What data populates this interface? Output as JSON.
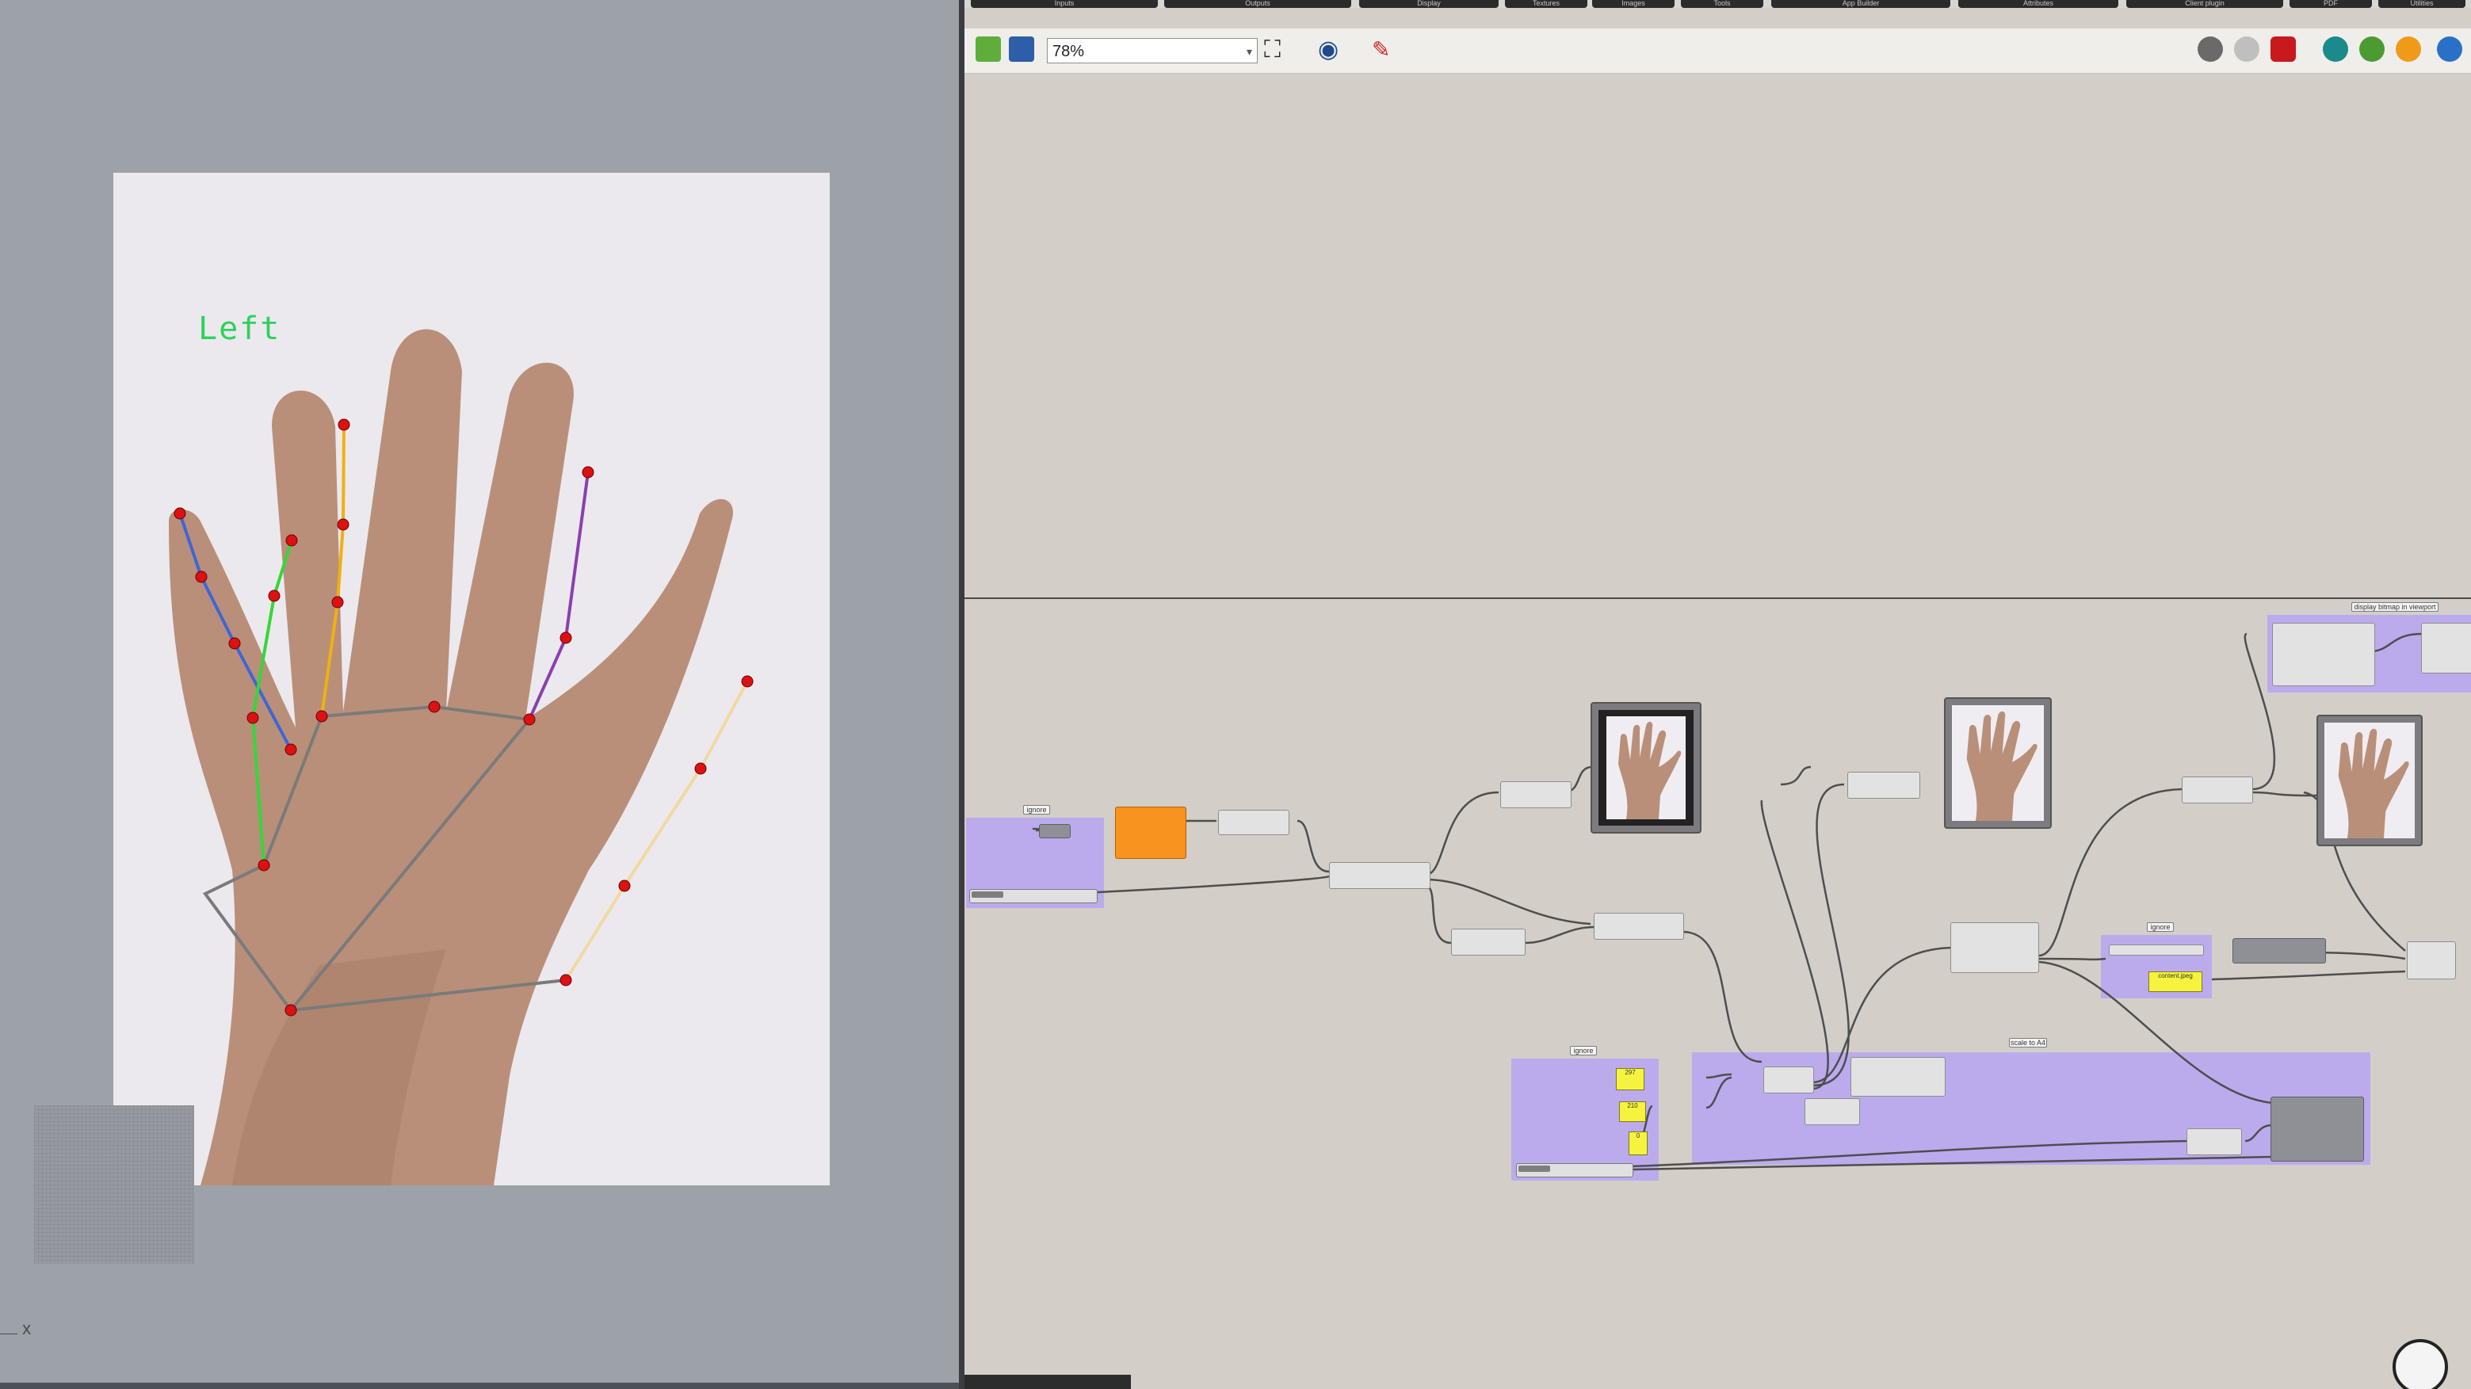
{
  "viewport": {
    "hand_label": "Left",
    "axis_label": "x"
  },
  "grasshopper": {
    "menu_tabs": [
      "Inputs",
      "Outputs",
      "Display",
      "Textures",
      "Images",
      "Tools",
      "App Builder",
      "Attributes",
      "Client plugin",
      "PDF",
      "Utilities"
    ],
    "zoom_value": "78%",
    "toolbar_icons": [
      "open-file-icon",
      "save-icon",
      "zoom-extents-icon",
      "preview-eye-icon",
      "sketch-brush-icon",
      "preview-off-icon",
      "wireframe-preview-icon",
      "shaded-preview-icon",
      "selected-only-icon",
      "mesh-preview-icon",
      "material-preview-icon",
      "globe-icon"
    ],
    "group_tags": {
      "left_group": "ignore",
      "bottom_group": "ignore",
      "scale_group": "scale to A4",
      "right_small_group": "ignore",
      "top_right_group": "display bitmap in viewport"
    },
    "panels": {
      "p1": "297",
      "p2": "210",
      "p3": "0",
      "right_panel": "content.jpeg"
    }
  },
  "colors": {
    "group_purple": "#b9a8f0",
    "orange_component": "#f7931e",
    "canvas_bg": "#d3cfc8",
    "viewport_bg": "#9da1a8"
  }
}
